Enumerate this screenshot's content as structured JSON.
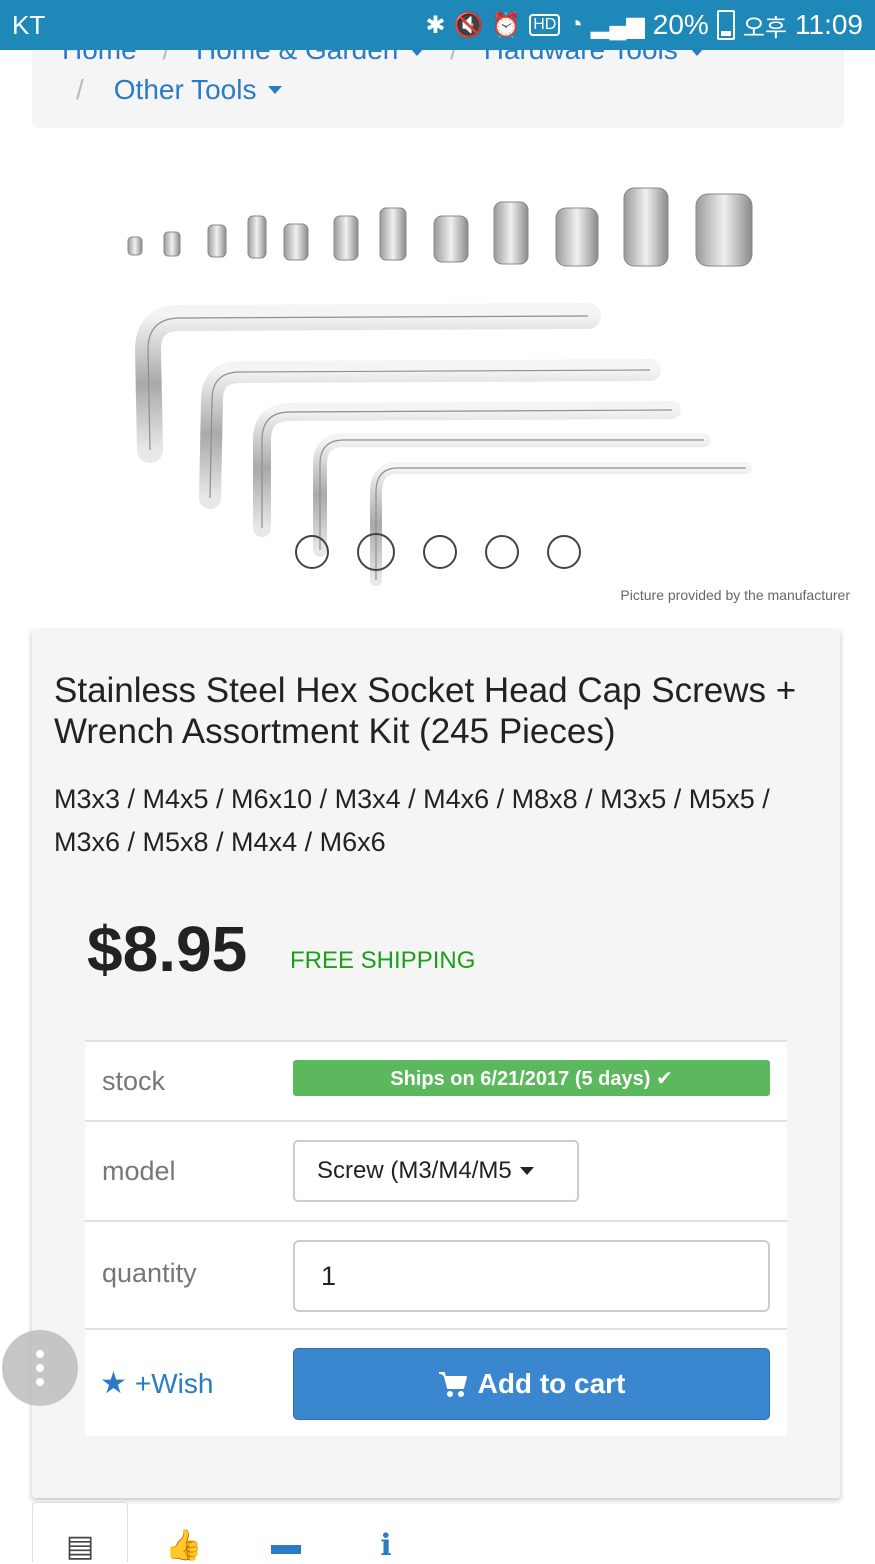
{
  "status_bar": {
    "carrier": "KT",
    "battery": "20%",
    "time_prefix": "오후",
    "time": "11:09"
  },
  "breadcrumb": {
    "items": [
      "Home",
      "Home & Garden",
      "Hardware Tools"
    ],
    "current": "Other Tools"
  },
  "gallery": {
    "credit": "Picture provided by the manufacturer",
    "slide_count": 5,
    "active_index": 1
  },
  "product": {
    "title": "Stainless Steel Hex Socket Head Cap Screws + Wrench Assortment Kit (245 Pieces)",
    "variants": "M3x3 / M4x5 / M6x10 / M3x4 / M4x6 / M8x8 / M3x5 / M5x5 / M3x6 / M5x8 / M4x4 / M6x6",
    "price": "$8.95",
    "shipping": "FREE SHIPPING"
  },
  "options": {
    "stock_label": "stock",
    "stock_status": "Ships on 6/21/2017 (5 days) ✔",
    "model_label": "model",
    "model_value": "Screw (M3/M4/M5",
    "quantity_label": "quantity",
    "quantity_value": "1",
    "wish_label": "+Wish",
    "add_to_cart_label": "Add to cart"
  },
  "colors": {
    "status_bar": "#1e88b8",
    "link": "#2a7bc6",
    "shipping": "#1aa01a",
    "stock_badge": "#5cb85c",
    "cart_button": "#3a87d0"
  }
}
